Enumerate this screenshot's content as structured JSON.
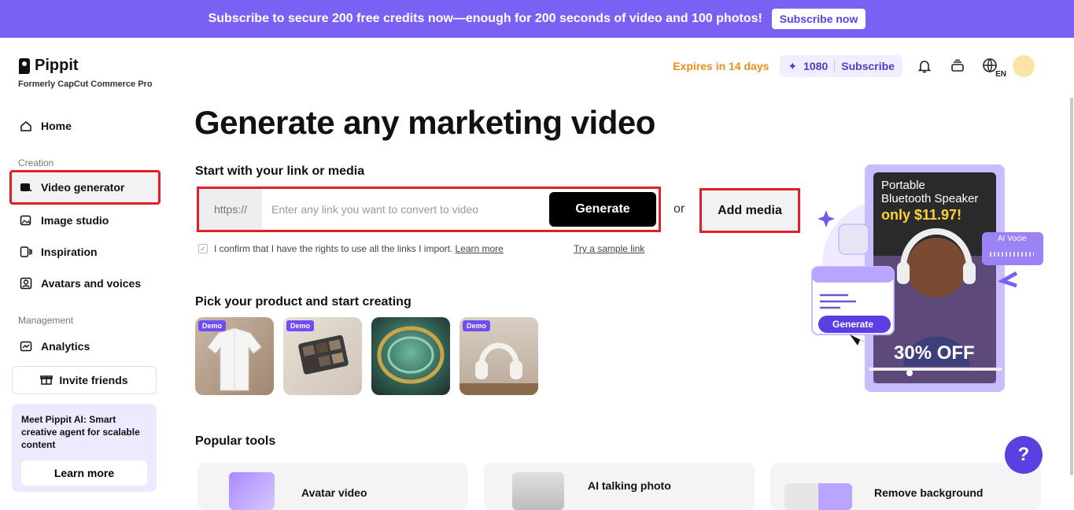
{
  "banner": {
    "text": "Subscribe to secure 200 free credits now—enough for 200 seconds of video and 100 photos!",
    "button": "Subscribe now"
  },
  "brand": {
    "name": "Pippit",
    "subtitle": "Formerly CapCut Commerce Pro"
  },
  "header": {
    "expires": "Expires in 14 days",
    "credits": "1080",
    "subscribe": "Subscribe",
    "language": "EN"
  },
  "sidebar": {
    "home": "Home",
    "section_creation": "Creation",
    "video_generator": "Video generator",
    "image_studio": "Image studio",
    "inspiration": "Inspiration",
    "avatars_voices": "Avatars and voices",
    "section_management": "Management",
    "analytics": "Analytics",
    "invite": "Invite friends",
    "promo_text": "Meet Pippit AI: Smart creative agent for scalable content",
    "promo_button": "Learn more"
  },
  "main": {
    "title": "Generate any marketing video",
    "start_heading": "Start with your link or media",
    "link_prefix": "https://",
    "link_placeholder": "Enter any link you want to convert to video",
    "generate": "Generate",
    "or": "or",
    "add_media": "Add media",
    "confirm_text": "I confirm that I have the rights to use all the links I import.",
    "learn_more": "Learn more",
    "sample_link": "Try a sample link",
    "pick_heading": "Pick your product and start creating",
    "demo_badge": "Demo",
    "popular_heading": "Popular tools",
    "tools": [
      "Avatar video",
      "AI talking photo",
      "Remove background"
    ]
  },
  "hero": {
    "line1": "Portable",
    "line2": "Bluetooth Speaker",
    "price": "only $11.97!",
    "discount": "30% OFF",
    "ai_voice": "AI Vocie",
    "generate": "Generate"
  },
  "colors": {
    "accent": "#7b61f3",
    "highlight": "#e01f2b",
    "expires": "#f08c1d"
  }
}
